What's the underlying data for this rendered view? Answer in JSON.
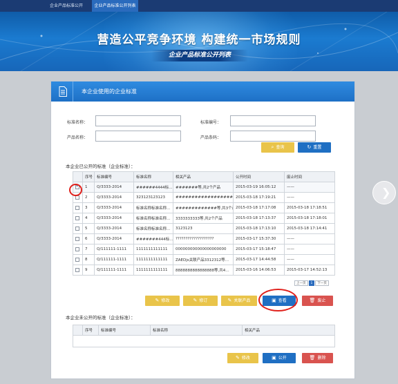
{
  "nav": {
    "tabs": [
      {
        "label": "企业产品标准公开"
      },
      {
        "label": "企业产品标准公开列表"
      }
    ]
  },
  "banner": {
    "title": "营造公平竞争环境 构建统一市场规则",
    "subtitle": "企业产品标准公开列表"
  },
  "panel": {
    "title": "本企业使用的企业标准"
  },
  "search": {
    "std_name_label": "标准名称：",
    "std_no_label": "标准编号：",
    "product_name_label": "产品名称：",
    "product_code_label": "产品条码：",
    "std_name_value": "",
    "std_no_value": "",
    "product_name_value": "",
    "product_code_value": "",
    "query_button": "查询",
    "reset_button": "重置"
  },
  "published": {
    "title": "本企业已公开的标准（企业标准）：",
    "headers": [
      "序号",
      "标准编号",
      "标准名称",
      "相关产品",
      "公开时间",
      "废止时间"
    ],
    "rows": [
      {
        "checked": true,
        "no": "1",
        "code": "Q/3333-2014",
        "name": "######4444标…",
        "product": "#######等,共2个产品",
        "pub": "2015-03-19 16:05:12",
        "abolish": "——"
      },
      {
        "checked": false,
        "no": "2",
        "code": "Q/3333-2014",
        "name": "323123123123",
        "product": "######################",
        "pub": "2015-03-18 17:19:21",
        "abolish": "——"
      },
      {
        "checked": false,
        "no": "3",
        "code": "Q/3333-2014",
        "name": "标准名称标准名称…",
        "product": "#############等,共3个产品",
        "pub": "2015-03-18 17:17:08",
        "abolish": "2015-03-18 17:18:51"
      },
      {
        "checked": false,
        "no": "4",
        "code": "Q/3333-2014",
        "name": "标准名称标准名称…",
        "product": "3333333333等,共2个产品",
        "pub": "2015-03-18 17:13:37",
        "abolish": "2015-03-18 17:18:01"
      },
      {
        "checked": false,
        "no": "5",
        "code": "Q/3333-2014",
        "name": "标准名称标准名称…",
        "product": "3123123",
        "pub": "2015-03-18 17:13:10",
        "abolish": "2015-03-18 17:14:41"
      },
      {
        "checked": false,
        "no": "6",
        "code": "Q/3333-2014",
        "name": "#######444标…",
        "product": "???????????????????",
        "pub": "2015-03-17 15:37:30",
        "abolish": "——"
      },
      {
        "checked": false,
        "no": "7",
        "code": "Q/111111-1111",
        "name": "1111111111111",
        "product": "000000000000000000000",
        "pub": "2015-03-17 15:18:47",
        "abolish": "——"
      },
      {
        "checked": false,
        "no": "8",
        "code": "Q/111111-1111",
        "name": "1111111111111",
        "product": "ZAEDjs关联产品3312312等…",
        "pub": "2015-03-17 14:44:58",
        "abolish": "——"
      },
      {
        "checked": false,
        "no": "9",
        "code": "Q/111111-1111",
        "name": "1111111111111",
        "product": "8888888888888888等,共4…",
        "pub": "2015-03-16 14:06:53",
        "abolish": "2015-03-17 14:52:13"
      }
    ],
    "pager": {
      "prev": "上一页",
      "current": "1",
      "next": "下一页"
    },
    "buttons": {
      "edit": "修改",
      "revise": "修订",
      "related": "关联产品",
      "view": "查看",
      "abolish": "废止"
    }
  },
  "unpublished": {
    "title": "本企业未公开的标准（企业标准）：",
    "headers": [
      "序号",
      "标准编号",
      "标准名称",
      "相关产品"
    ],
    "buttons": {
      "edit": "修改",
      "publish": "公开",
      "delete": "删除"
    }
  },
  "colors": {
    "nav_bg": "#1b3b73",
    "header_blue": "#1e70c6",
    "yellow_button": "#e9c44a",
    "blue_button": "#1f6fc3",
    "red_button": "#d9534f",
    "highlight_circle": "#e0201b"
  },
  "icons": {
    "panel": "document-icon",
    "query": "search-icon",
    "reset": "refresh-icon",
    "edit": "pencil-icon",
    "view": "view-icon",
    "abolish": "trash-icon",
    "publish": "publish-icon",
    "side": "chevron-right-icon"
  }
}
